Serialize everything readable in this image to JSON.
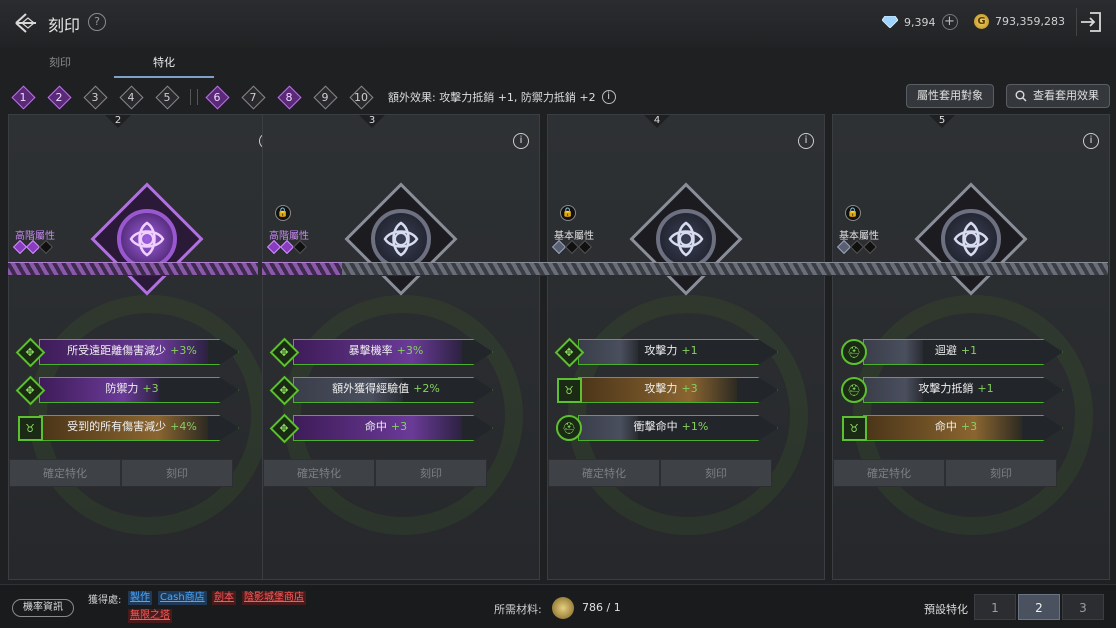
{
  "header": {
    "title": "刻印",
    "help_glyph": "?",
    "diamonds": "9,394",
    "diamonds_plus": "+",
    "gold": "793,359,283",
    "gold_glyph": "G"
  },
  "tabs": [
    {
      "label": "刻印",
      "active": false
    },
    {
      "label": "特化",
      "active": true
    }
  ],
  "slots": [
    {
      "n": "1",
      "state": "purple"
    },
    {
      "n": "2",
      "state": "purple"
    },
    {
      "n": "3",
      "state": "gray"
    },
    {
      "n": "4",
      "state": "gray"
    },
    {
      "n": "5",
      "state": "gray"
    },
    {
      "n": "6",
      "state": "purple"
    },
    {
      "n": "7",
      "state": "gray"
    },
    {
      "n": "8",
      "state": "purple"
    },
    {
      "n": "9",
      "state": "gray"
    },
    {
      "n": "10",
      "state": "gray"
    }
  ],
  "bonus": {
    "text": "額外效果: 攻擊力抵銷 +1, 防禦力抵銷 +2",
    "info_glyph": "i"
  },
  "buttons": {
    "attr_target": "屬性套用對象",
    "view_effect": "查看套用效果"
  },
  "panels": [
    {
      "num": "2",
      "locked": false,
      "attr_label": "高階屬性",
      "attr_color": "purple",
      "gems": [
        "p",
        "p",
        "b"
      ],
      "emblem": "purple",
      "stats": [
        {
          "icon": "diamond",
          "glyph": "✥",
          "name": "所受遠距離傷害減少",
          "val": "+3%",
          "fill": "purple",
          "fill_frac": 0.85
        },
        {
          "icon": "diamond",
          "glyph": "✥",
          "name": "防禦力",
          "val": "+3",
          "fill": "purple",
          "fill_frac": 0.6
        },
        {
          "icon": "square",
          "glyph": "♉",
          "name": "受到的所有傷害減少",
          "val": "+4%",
          "fill": "gold",
          "fill_frac": 0.85
        }
      ],
      "confirm": "確定特化",
      "engrave": "刻印"
    },
    {
      "num": "3",
      "locked": true,
      "attr_label": "高階屬性",
      "attr_color": "purple",
      "gems": [
        "p",
        "p",
        "b"
      ],
      "emblem": "slate",
      "stats": [
        {
          "icon": "diamond",
          "glyph": "✥",
          "name": "暴擊機率",
          "val": "+3%",
          "fill": "purple",
          "fill_frac": 0.85
        },
        {
          "icon": "diamond",
          "glyph": "✥",
          "name": "額外獲得經驗值",
          "val": "+2%",
          "fill": "slate",
          "fill_frac": 0.55
        },
        {
          "icon": "diamond",
          "glyph": "✥",
          "name": "命中",
          "val": "+3",
          "fill": "purple",
          "fill_frac": 0.85
        }
      ],
      "confirm": "確定特化",
      "engrave": "刻印"
    },
    {
      "num": "4",
      "locked": true,
      "attr_label": "基本屬性",
      "attr_color": "white",
      "gems": [
        "g",
        "b",
        "b"
      ],
      "emblem": "slate",
      "stats": [
        {
          "icon": "diamond",
          "glyph": "✥",
          "name": "攻擊力",
          "val": "+1",
          "fill": "slate",
          "fill_frac": 0.3
        },
        {
          "icon": "square",
          "glyph": "♉",
          "name": "攻擊力",
          "val": "+3",
          "fill": "gold",
          "fill_frac": 0.8
        },
        {
          "icon": "circle",
          "glyph": "⛑",
          "name": "衝擊命中",
          "val": "+1%",
          "fill": "slate",
          "fill_frac": 0.3
        }
      ],
      "confirm": "確定特化",
      "engrave": "刻印"
    },
    {
      "num": "5",
      "locked": true,
      "attr_label": "基本屬性",
      "attr_color": "white",
      "gems": [
        "g",
        "b",
        "b"
      ],
      "emblem": "slate",
      "stats": [
        {
          "icon": "circle",
          "glyph": "⛑",
          "name": "迴避",
          "val": "+1",
          "fill": "slate",
          "fill_frac": 0.3
        },
        {
          "icon": "circle",
          "glyph": "⛑",
          "name": "攻擊力抵銷",
          "val": "+1",
          "fill": "slate",
          "fill_frac": 0.3
        },
        {
          "icon": "square",
          "glyph": "♉",
          "name": "命中",
          "val": "+3",
          "fill": "gold",
          "fill_frac": 0.8
        }
      ],
      "confirm": "確定特化",
      "engrave": "刻印"
    }
  ],
  "footer": {
    "rate_info": "機率資訊",
    "obtain_label": "獲得處:",
    "obtain_links": [
      {
        "text": "製作",
        "color": "blue"
      },
      {
        "text": "Cash商店",
        "color": "blue"
      },
      {
        "text": "劍本",
        "color": "red"
      },
      {
        "text": "陰影城堡商店",
        "color": "red"
      },
      {
        "text": "無限之塔",
        "color": "red"
      }
    ],
    "materials_label": "所需材料:",
    "materials_value": "786 / 1",
    "preset_label": "預設特化",
    "presets": [
      "1",
      "2",
      "3"
    ],
    "preset_active": "2"
  },
  "colors": {
    "purple_accent": "#b070e0",
    "green_border": "#4cb02a",
    "gold_fill": "#8a6530",
    "link_blue": "#4aa8ff",
    "link_red": "#ff5a5a"
  },
  "icons": {
    "back": "back-arrow-icon",
    "help": "question-circle-icon",
    "diamond": "diamond-gem-icon",
    "gold": "gold-coin-icon",
    "exit": "exit-door-icon",
    "info": "info-circle-icon",
    "lock": "lock-icon",
    "search": "search-icon"
  }
}
